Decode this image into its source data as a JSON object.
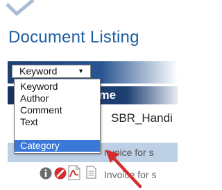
{
  "page": {
    "title": "Document Listing"
  },
  "search": {
    "selected": "Keyword"
  },
  "dropdown": {
    "options": [
      "Keyword",
      "Author",
      "Comment",
      "Text",
      "Category"
    ],
    "highlighted": "Category"
  },
  "table": {
    "header_visible": "ame",
    "rows": [
      {
        "title": "SBR_Handi"
      },
      {
        "title": "nvoice for s"
      },
      {
        "title": "Invoice for s"
      }
    ]
  },
  "colors": {
    "title_blue": "#1f5da1",
    "header_navy": "#1e3f72",
    "selection_blue": "#3a78d8",
    "row_highlight": "#bed0e6",
    "arrow_red": "#d32f2f"
  },
  "icons": [
    "logo-check-icon",
    "chevron-down-icon",
    "info-icon",
    "no-entry-icon",
    "pdf-icon",
    "document-icon",
    "arrow-pointer-icon"
  ]
}
